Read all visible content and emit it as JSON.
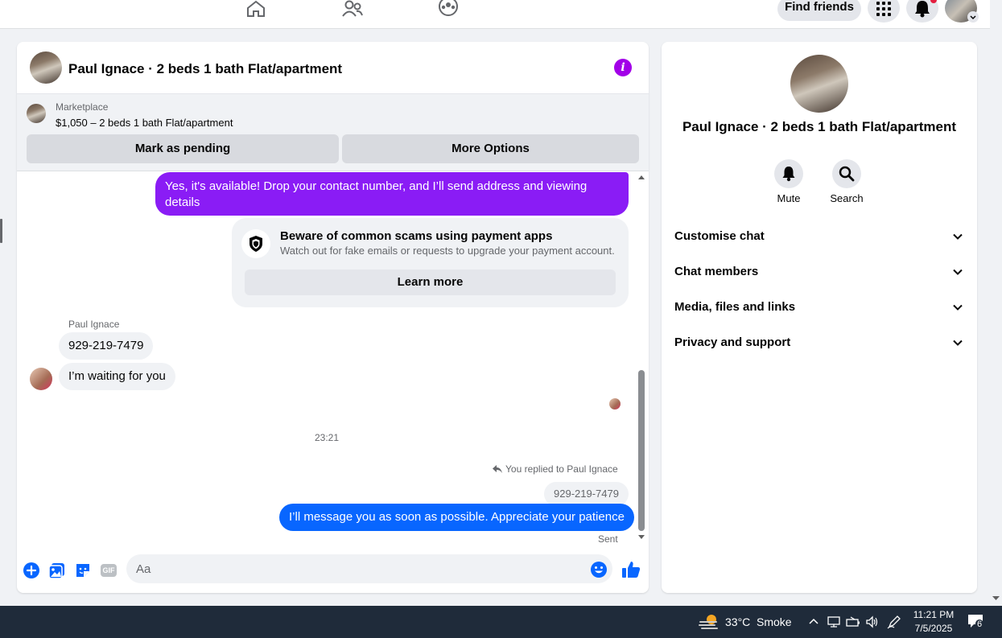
{
  "topbar": {
    "find_friends": "Find friends"
  },
  "chat": {
    "title": "Paul Ignace · 2 beds 1 bath Flat/apartment",
    "marketplace": {
      "label": "Marketplace",
      "item": "$1,050 – 2 beds 1 bath Flat/apartment",
      "mark_pending": "Mark as pending",
      "more_options": "More Options"
    },
    "messages": {
      "outgoing_1": "Yes, it's available! Drop your contact number, and I’ll send address and viewing details",
      "scam_title": "Beware of common scams using payment apps",
      "scam_subtitle": "Watch out for fake emails or requests to upgrade your payment account.",
      "learn_more": "Learn more",
      "sender_name": "Paul Ignace",
      "incoming_1": "929-219-7479",
      "incoming_2": "I’m waiting for you",
      "timestamp": "23:21",
      "replied_to": "You replied to Paul Ignace",
      "reply_quote": "929-219-7479",
      "outgoing_2": "I’ll message you as soon as possible. Appreciate your patience",
      "status": "Sent"
    },
    "composer": {
      "placeholder": "Aa",
      "gif": "GIF"
    }
  },
  "info_panel": {
    "title": "Paul Ignace · 2 beds 1 bath Flat/apartment",
    "actions": [
      {
        "label": "Mute",
        "icon": "bell-icon"
      },
      {
        "label": "Search",
        "icon": "search-icon"
      }
    ],
    "menu": [
      "Customise chat",
      "Chat members",
      "Media, files and links",
      "Privacy and support"
    ]
  },
  "taskbar": {
    "weather_temp": "33°C",
    "weather_desc": "Smoke",
    "time": "11:21 PM",
    "date": "7/5/2025",
    "notifications": "6"
  },
  "colors": {
    "accent_blue": "#0866ff",
    "accent_purple": "#8a1cf5",
    "info_purple": "#a200e8"
  }
}
